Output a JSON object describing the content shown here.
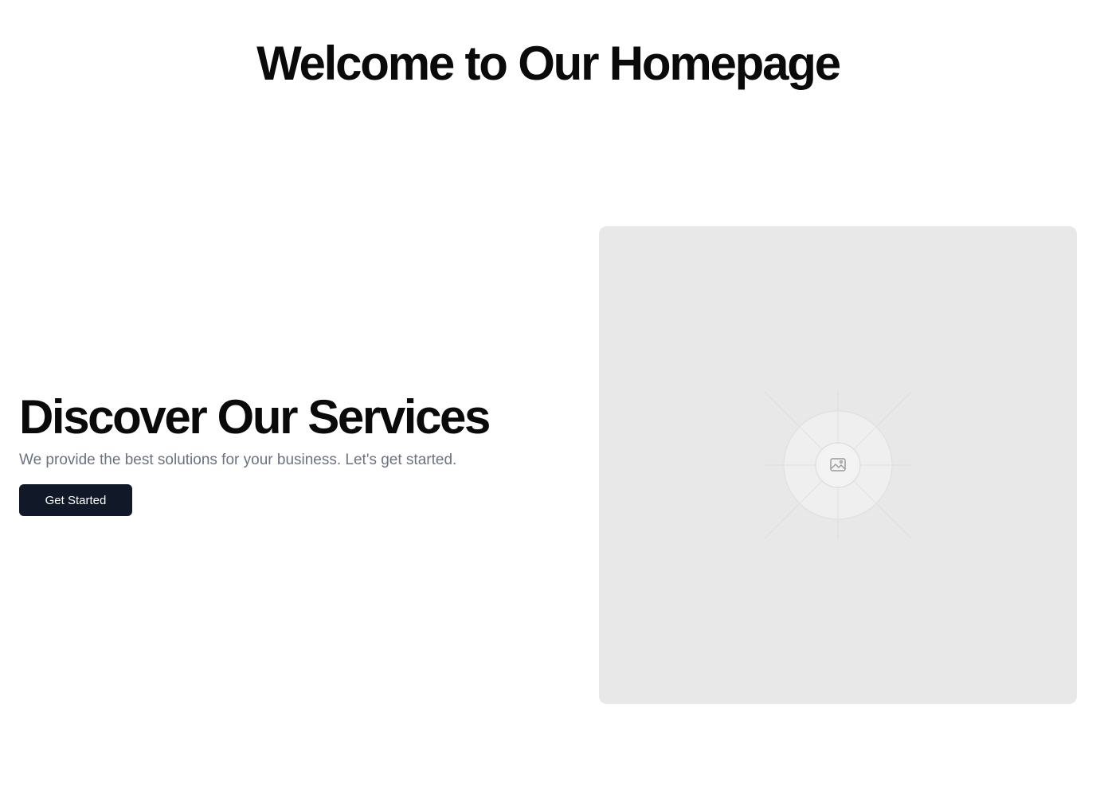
{
  "page": {
    "title": "Welcome to Our Homepage"
  },
  "hero": {
    "heading": "Discover Our Services",
    "subtitle": "We provide the best solutions for your business. Let's get started.",
    "cta_label": "Get Started",
    "image_icon": "image-icon"
  },
  "colors": {
    "heading": "#0a0a0a",
    "subtitle": "#6b7280",
    "button_bg": "#111827",
    "button_text": "#ffffff",
    "placeholder_bg": "#e8e8e8"
  }
}
